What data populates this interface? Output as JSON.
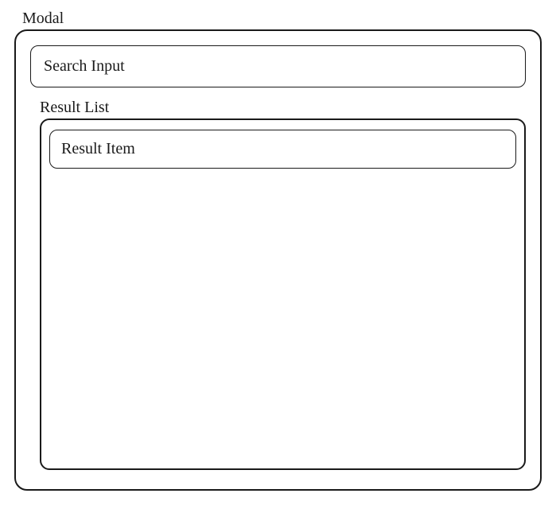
{
  "modal": {
    "title": "Modal",
    "search": {
      "placeholder": "Search Input",
      "value": ""
    },
    "result_list": {
      "title": "Result List",
      "items": [
        {
          "label": "Result Item"
        }
      ]
    }
  }
}
